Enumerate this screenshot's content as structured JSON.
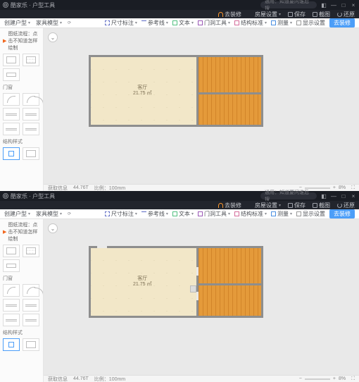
{
  "app": {
    "brand": "酷家乐",
    "section": "户型工具",
    "search_placeholder": "通用：知道要问谁后搜",
    "win": {
      "min": "—",
      "max": "□",
      "close": "×",
      "extra": "◧"
    }
  },
  "menubar": {
    "cloud": "去装修",
    "settings": "房屋设置",
    "save": "保存",
    "camera": "截图",
    "reload": "还原"
  },
  "controlbar": {
    "left": [
      {
        "label": "创建户型"
      },
      {
        "label": "家具模型"
      }
    ],
    "right": [
      {
        "id": "dim",
        "label": "尺寸标注"
      },
      {
        "id": "line",
        "label": "参考线"
      },
      {
        "id": "text",
        "label": "文本"
      },
      {
        "id": "door",
        "label": "门洞工具"
      },
      {
        "id": "struct",
        "label": "结构标准"
      },
      {
        "id": "measure",
        "label": "测量"
      },
      {
        "id": "show",
        "label": "显示设置"
      }
    ],
    "primary_btn": "去装修"
  },
  "sidebar": {
    "header": "图纸流程：点击不知道怎样绘制",
    "cat_door": "门窗",
    "cat_struct": "结构样式"
  },
  "statusbar": {
    "d1": "获取信息",
    "scale_label": "比例：",
    "scale_value": "100mm",
    "precision": "44.76T",
    "zoom_minus": "−",
    "zoom_plus": "+",
    "zoom_pct": "8%"
  },
  "plan1": {
    "room_label": "客厅",
    "room_area": "21.75 ㎡"
  },
  "plan2": {
    "room_label": "客厅",
    "room_area": "21.75 ㎡"
  }
}
